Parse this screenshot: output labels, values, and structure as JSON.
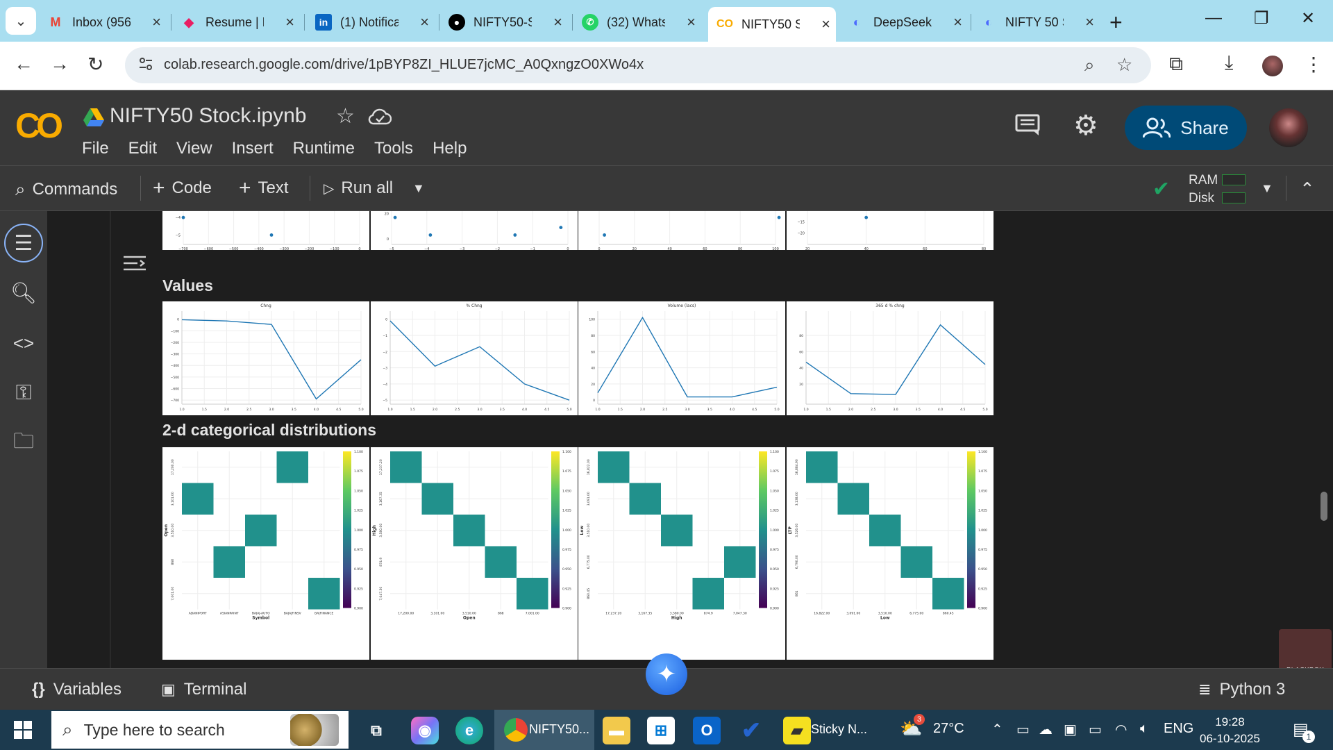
{
  "browser": {
    "tabs": [
      {
        "label": "Inbox (956",
        "icon": "gmail-icon",
        "color": "#ea4335"
      },
      {
        "label": "Resume | F",
        "icon": "resume-icon",
        "color": "#e91e63"
      },
      {
        "label": "(1) Notifica",
        "icon": "linkedin-icon",
        "color": "#0a66c2"
      },
      {
        "label": "NIFTY50-S",
        "icon": "github-icon",
        "color": "#000000"
      },
      {
        "label": "(32) Whats",
        "icon": "whatsapp-icon",
        "color": "#25d366"
      },
      {
        "label": "NIFTY50 St",
        "icon": "colab-icon",
        "color": "#f9ab00"
      },
      {
        "label": "DeepSeek",
        "icon": "deepseek-icon",
        "color": "#4d6bfe"
      },
      {
        "label": "NIFTY 50 S",
        "icon": "deepseek-icon",
        "color": "#4d6bfe"
      }
    ],
    "url": "colab.research.google.com/drive/1pBYP8ZI_HLUE7jcMC_A0QxngzO0XWo4x"
  },
  "colab": {
    "notebook_title": "NIFTY50 Stock.ipynb",
    "menu": [
      "File",
      "Edit",
      "View",
      "Insert",
      "Runtime",
      "Tools",
      "Help"
    ],
    "share_label": "Share",
    "toolbar": {
      "commands": "Commands",
      "code": "Code",
      "text": "Text",
      "run_all": "Run all",
      "ram": "RAM",
      "disk": "Disk"
    },
    "bottom": {
      "variables": "Variables",
      "terminal": "Terminal",
      "runtime": "Python 3"
    },
    "watermark": "BLACKBOX"
  },
  "sections": {
    "values": "Values",
    "categorical": "2-d categorical distributions"
  },
  "chart_data": [
    {
      "type": "scatter",
      "xlabel": "Chng",
      "x": [
        -700,
        -350
      ],
      "y": [
        -4.0,
        -5.0
      ],
      "xticks": [
        "−700",
        "−600",
        "−500",
        "−400",
        "−300",
        "−200",
        "−100",
        "0"
      ],
      "yticks": [
        "−4",
        "−5"
      ]
    },
    {
      "type": "scatter",
      "xlabel": "% Chng",
      "x": [
        -4.9,
        -3.9,
        -1.5,
        -0.2
      ],
      "y": [
        17,
        3,
        3,
        9
      ],
      "xticks": [
        "−5",
        "−4",
        "−3",
        "−2",
        "−1",
        "0"
      ],
      "yticks": [
        "20",
        "0"
      ]
    },
    {
      "type": "scatter",
      "xlabel": "Volume (lacs)",
      "x": [
        3,
        102
      ],
      "y": [
        7,
        8
      ],
      "xticks": [
        "0",
        "20",
        "40",
        "60",
        "80",
        "100"
      ],
      "yticks": [
        "20"
      ]
    },
    {
      "type": "scatter",
      "xlabel": "365 d % chng",
      "x": [
        8,
        40
      ],
      "y": [
        -21,
        -13
      ],
      "xticks": [
        "20",
        "40",
        "60",
        "80"
      ],
      "yticks": [
        "−15",
        "−20"
      ]
    },
    {
      "type": "line",
      "title": "Chng",
      "x": [
        1,
        2,
        3,
        4,
        5
      ],
      "values": [
        -5,
        -15,
        -45,
        -690,
        -350
      ],
      "ylim": [
        -700,
        0
      ],
      "yticks": [
        "0",
        "−100",
        "−200",
        "−300",
        "−400",
        "−500",
        "−600",
        "−700"
      ],
      "xticks": [
        "1.0",
        "1.5",
        "2.0",
        "2.5",
        "3.0",
        "3.5",
        "4.0",
        "4.5",
        "5.0"
      ]
    },
    {
      "type": "line",
      "title": "% Chng",
      "x": [
        1,
        2,
        3,
        4,
        5
      ],
      "values": [
        -0.1,
        -2.9,
        -1.7,
        -4.0,
        -5.0
      ],
      "ylim": [
        -5,
        0
      ],
      "yticks": [
        "0",
        "−1",
        "−2",
        "−3",
        "−4",
        "−5"
      ],
      "xticks": [
        "1.0",
        "1.5",
        "2.0",
        "2.5",
        "3.0",
        "3.5",
        "4.0",
        "4.5",
        "5.0"
      ]
    },
    {
      "type": "line",
      "title": "Volume (lacs)",
      "x": [
        1,
        2,
        3,
        4,
        5
      ],
      "values": [
        9,
        102,
        4,
        4,
        16
      ],
      "ylim": [
        0,
        100
      ],
      "yticks": [
        "100",
        "80",
        "60",
        "40",
        "20",
        "0"
      ],
      "xticks": [
        "1.0",
        "1.5",
        "2.0",
        "2.5",
        "3.0",
        "3.5",
        "4.0",
        "4.5",
        "5.0"
      ]
    },
    {
      "type": "line",
      "title": "365 d % chng",
      "x": [
        1,
        2,
        3,
        4,
        5
      ],
      "values": [
        47,
        8,
        7,
        93,
        44
      ],
      "ylim": [
        0,
        100
      ],
      "yticks": [
        "80",
        "60",
        "40",
        "20"
      ],
      "xticks": [
        "1.0",
        "1.5",
        "2.0",
        "2.5",
        "3.0",
        "3.5",
        "4.0",
        "4.5",
        "5.0"
      ]
    },
    {
      "type": "heatmap",
      "xlabel": "Symbol",
      "ylabel": "Open",
      "xcats": [
        "ADANIPORT",
        "ASIANPAINT",
        "BAJAJ-AUTO",
        "BAJAJFINSV",
        "BAJFINANCE"
      ],
      "ycats": [
        "17,200.00",
        "3,101.00",
        "3,510.00",
        "868",
        "7,001.00"
      ],
      "cells": [
        [
          3,
          0
        ],
        [
          0,
          1
        ],
        [
          2,
          2
        ],
        [
          1,
          3
        ],
        [
          4,
          4
        ]
      ],
      "colorbar": [
        "1.100",
        "1.075",
        "1.050",
        "1.025",
        "1.000",
        "0.975",
        "0.950",
        "0.925",
        "0.900"
      ]
    },
    {
      "type": "heatmap",
      "xlabel": "Open",
      "ylabel": "High",
      "xcats": [
        "17,200.00",
        "3,101.00",
        "3,510.00",
        "868",
        "7,001.00"
      ],
      "ycats": [
        "17,237.20",
        "3,167.35",
        "3,580.00",
        "874.9",
        "7,047.30"
      ],
      "cells": [
        [
          0,
          0
        ],
        [
          1,
          1
        ],
        [
          2,
          2
        ],
        [
          3,
          3
        ],
        [
          4,
          4
        ]
      ],
      "colorbar": [
        "1.100",
        "1.075",
        "1.050",
        "1.025",
        "1.000",
        "0.975",
        "0.950",
        "0.925",
        "0.900"
      ]
    },
    {
      "type": "heatmap",
      "xlabel": "High",
      "ylabel": "Low",
      "xcats": [
        "17,237.20",
        "3,167.35",
        "3,580.00",
        "874.9",
        "7,047.30"
      ],
      "ycats": [
        "16,822.00",
        "3,091.00",
        "3,510.00",
        "6,775.00",
        "860.45"
      ],
      "cells": [
        [
          0,
          0
        ],
        [
          1,
          1
        ],
        [
          2,
          2
        ],
        [
          4,
          3
        ],
        [
          3,
          4
        ]
      ],
      "colorbar": [
        "1.100",
        "1.075",
        "1.050",
        "1.025",
        "1.000",
        "0.975",
        "0.950",
        "0.925",
        "0.900"
      ]
    },
    {
      "type": "heatmap",
      "xlabel": "Low",
      "ylabel": "LTP",
      "xcats": [
        "16,822.00",
        "3,091.00",
        "3,510.00",
        "6,775.00",
        "860.45"
      ],
      "ycats": [
        "16,884.90",
        "3,138.00",
        "3,526.00",
        "6,790.00",
        "861"
      ],
      "cells": [
        [
          0,
          0
        ],
        [
          1,
          1
        ],
        [
          2,
          2
        ],
        [
          3,
          3
        ],
        [
          4,
          4
        ]
      ],
      "colorbar": [
        "1.100",
        "1.075",
        "1.050",
        "1.025",
        "1.000",
        "0.975",
        "0.950",
        "0.925",
        "0.900"
      ]
    }
  ],
  "taskbar": {
    "search_placeholder": "Type here to search",
    "chrome_label": "NIFTY50...",
    "sticky_label": "Sticky N...",
    "weather": "27°C",
    "weather_badge": "3",
    "lang": "ENG",
    "time": "19:28",
    "date": "06-10-2025",
    "notif_count": "1"
  }
}
